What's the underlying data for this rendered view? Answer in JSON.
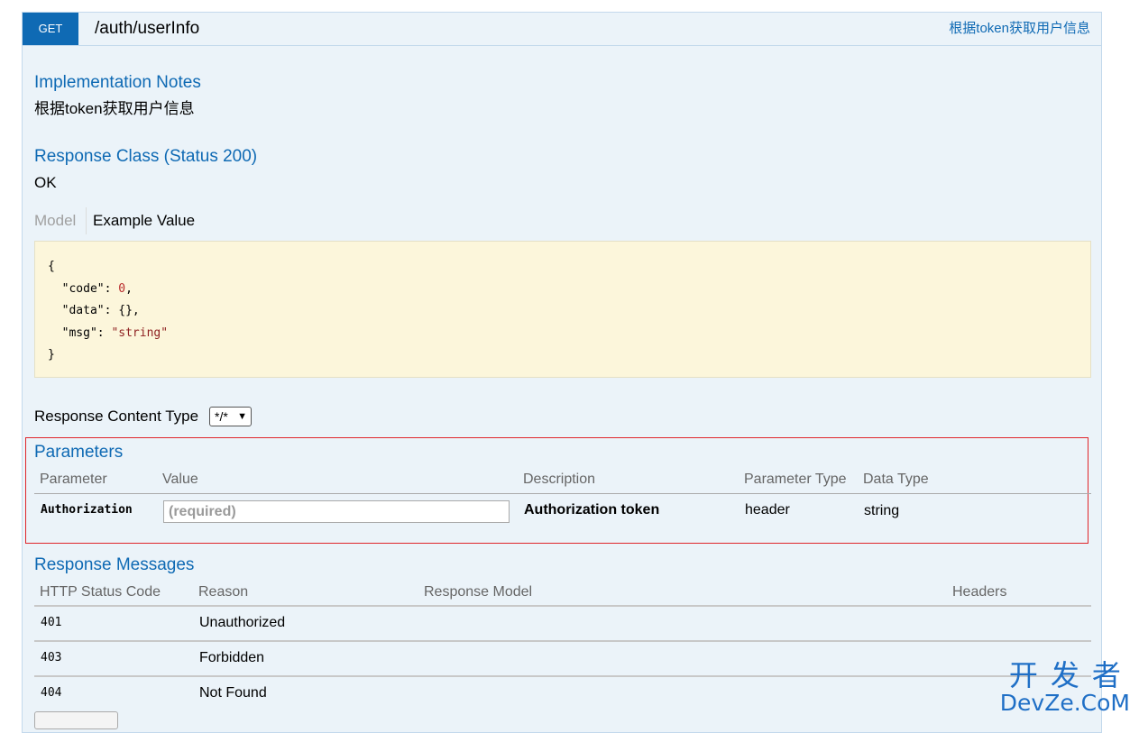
{
  "operation": {
    "method": "GET",
    "path": "/auth/userInfo",
    "summary": "根据token获取用户信息"
  },
  "implementation_notes": {
    "heading": "Implementation Notes",
    "text": "根据token获取用户信息"
  },
  "response_class": {
    "heading": "Response Class (Status 200)",
    "text": "OK",
    "tabs": {
      "model": "Model",
      "example": "Example Value"
    },
    "example_lines": {
      "open": "{",
      "code_key": "  \"code\": ",
      "code_val": "0",
      "code_end": ",",
      "data_line": "  \"data\": {},",
      "msg_key": "  \"msg\": ",
      "msg_val": "\"string\"",
      "close": "}"
    }
  },
  "response_content_type": {
    "label": "Response Content Type",
    "selected": "*/*"
  },
  "parameters": {
    "heading": "Parameters",
    "columns": {
      "parameter": "Parameter",
      "value": "Value",
      "description": "Description",
      "parameter_type": "Parameter Type",
      "data_type": "Data Type"
    },
    "row": {
      "name": "Authorization",
      "placeholder": "(required)",
      "description": "Authorization token",
      "parameter_type": "header",
      "data_type": "string"
    }
  },
  "response_messages": {
    "heading": "Response Messages",
    "columns": {
      "status": "HTTP Status Code",
      "reason": "Reason",
      "model": "Response Model",
      "headers": "Headers"
    },
    "rows": [
      {
        "code": "401",
        "reason": "Unauthorized"
      },
      {
        "code": "403",
        "reason": "Forbidden"
      },
      {
        "code": "404",
        "reason": "Not Found"
      }
    ]
  },
  "watermark": {
    "cn": "开发者",
    "en": "DevZe.CoM"
  },
  "colors": {
    "method_bg": "#0f6ab4",
    "link": "#0f6ab4",
    "panel_bg": "#ebf3f9",
    "highlight_border": "#e0262b"
  }
}
